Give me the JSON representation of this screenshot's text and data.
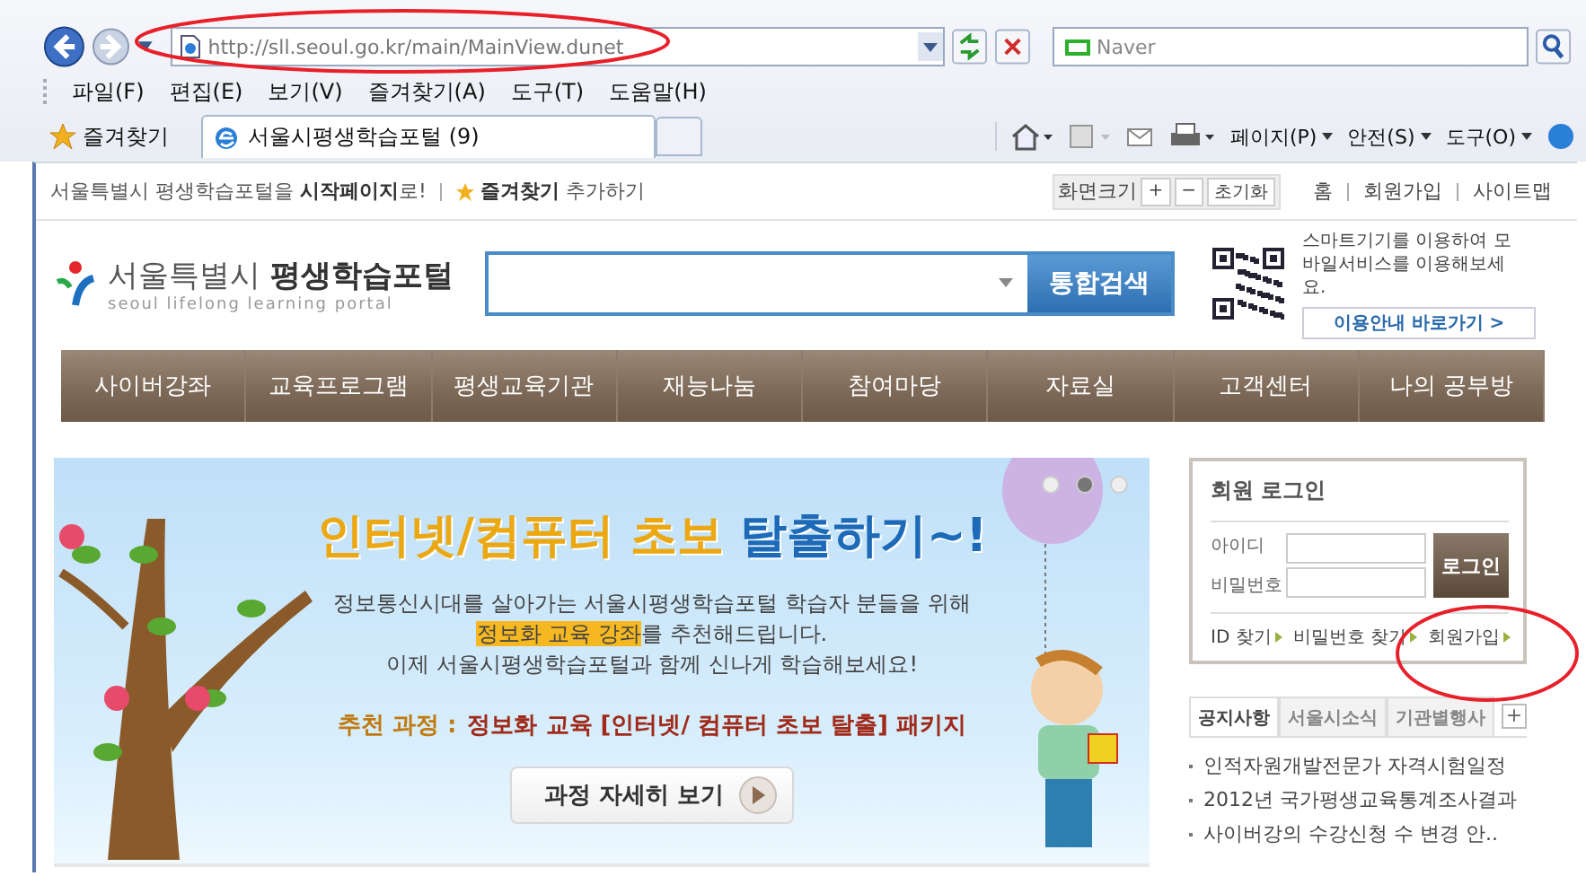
{
  "browser": {
    "address": "http://sll.seoul.go.kr/main/MainView.dunet",
    "search_placeholder": "Naver",
    "menu": [
      "파일(F)",
      "편집(E)",
      "보기(V)",
      "즐겨찾기(A)",
      "도구(T)",
      "도움말(H)"
    ],
    "favorites_label": "즐겨찾기",
    "tabs": [
      {
        "label": "서울시평생학습포털 (9)",
        "selected": true
      }
    ],
    "tools": [
      "페이지(P)",
      "안전(S)",
      "도구(O)"
    ]
  },
  "utility_bar": {
    "start_page": "서울특별시 평생학습포털을 **시작페이지**로!",
    "favorite": "**즐겨찾기** 추가하기",
    "zoom_label": "화면크기",
    "zoom_in": "+",
    "zoom_out": "−",
    "zoom_reset": "초기화",
    "links": [
      "홈",
      "회원가입",
      "사이트맵"
    ]
  },
  "header": {
    "logo_title": "서울특별시 **평생학습포털**",
    "logo_subtitle": "seoul lifelong learning portal",
    "search_button": "통합검색",
    "mobile_text": "스마트기기를 이용하여 모바일서비스를 이용해보세요.",
    "mobile_button": "이용안내 바로가기 >"
  },
  "nav": [
    "사이버강좌",
    "교육프로그램",
    "평생교육기관",
    "재능나눔",
    "참여마당",
    "자료실",
    "고객센터",
    "나의 공부방"
  ],
  "banner": {
    "title": [
      {
        "text": "인터넷/컴퓨터 초보",
        "kind": "accent"
      },
      {
        "text": " 탈출하기~!",
        "kind": "main"
      }
    ],
    "description": [
      [
        {
          "text": "정보통신시대를 살아가는 서울시평생학습포털 학습자 분들을 위해",
          "kind": "plain"
        }
      ],
      [
        {
          "text": "정보화 교육 강좌",
          "kind": "highlight"
        },
        {
          "text": "를 추천해드립니다.",
          "kind": "plain"
        }
      ],
      [
        {
          "text": "이제 서울시평생학습포털과 함께 신나게 학습해보세요!",
          "kind": "plain"
        }
      ]
    ],
    "course_label": "추천 과정 :",
    "course_name": "정보화 교육 [인터넷/ 컴퓨터 초보 탈출] 패키지",
    "button": "과정 자세히 보기",
    "dots": [
      {
        "selected": false
      },
      {
        "selected": true
      },
      {
        "selected": false
      }
    ]
  },
  "login": {
    "title": "회원 로그인",
    "id_label": "아이디",
    "password_label": "비밀번호",
    "button": "로그인",
    "links": [
      "ID 찾기",
      "비밀번호 찾기",
      "회원가입"
    ]
  },
  "news": {
    "tabs": [
      {
        "label": "공지사항",
        "selected": true
      },
      {
        "label": "서울시소식",
        "selected": false
      },
      {
        "label": "기관별행사",
        "selected": false
      }
    ],
    "more": "+",
    "items": [
      "인적자원개발전문가 자격시험일정",
      "2012년 국가평생교육통계조사결과",
      "사이버강의 수강신청 수 변경 안.."
    ]
  }
}
